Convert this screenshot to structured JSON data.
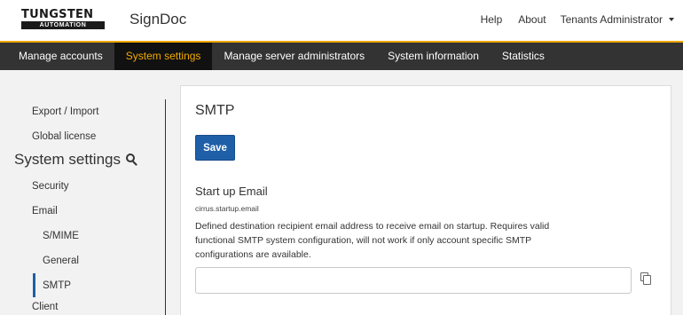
{
  "header": {
    "logo_top": "TUNGSTEN",
    "logo_bottom": "AUTOMATION",
    "app_name": "SignDoc",
    "links": {
      "help": "Help",
      "about": "About"
    },
    "user": "Tenants Administrator"
  },
  "nav": {
    "tabs": [
      {
        "label": "Manage accounts"
      },
      {
        "label": "System settings",
        "active": true
      },
      {
        "label": "Manage server administrators"
      },
      {
        "label": "System information"
      },
      {
        "label": "Statistics"
      }
    ],
    "active_color": "#f2a900"
  },
  "sidebar": {
    "export_import": "Export / Import",
    "global_license": "Global license",
    "heading": "System settings",
    "security": "Security",
    "email": "Email",
    "smime": "S/MIME",
    "general": "General",
    "smtp": "SMTP",
    "client": "Client"
  },
  "main": {
    "title": "SMTP",
    "save_label": "Save",
    "field": {
      "label": "Start up Email",
      "key": "cirrus.startup.email",
      "description": "Defined destination recipient email address to receive email on startup. Requires valid functional SMTP system configuration, will not work if only account specific SMTP configurations are available.",
      "value": ""
    }
  },
  "colors": {
    "accent": "#1e5fa8",
    "nav_bg": "#333333",
    "nav_highlight": "#f2a900"
  },
  "icons": [
    "search-icon",
    "copy-icon",
    "caret-down-icon"
  ]
}
